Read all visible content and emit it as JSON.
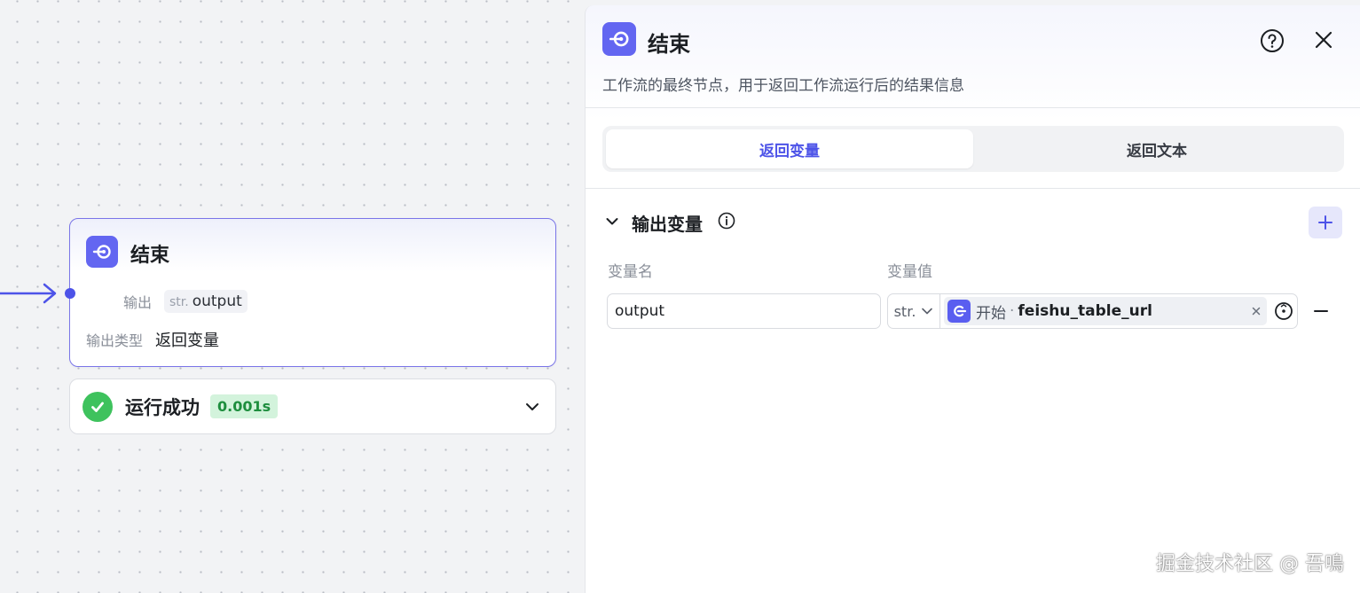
{
  "canvas": {
    "node": {
      "title": "结束",
      "output_label": "输出",
      "output_type_prefix": "str.",
      "output_name": "output",
      "output_kind_label": "输出类型",
      "output_kind_value": "返回变量",
      "icon": "end-node-icon"
    },
    "run": {
      "status": "运行成功",
      "duration": "0.001s",
      "icon": "check-circle-icon"
    }
  },
  "panel": {
    "title": "结束",
    "description": "工作流的最终节点，用于返回工作流运行后的结果信息",
    "tabs": [
      {
        "label": "返回变量",
        "active": true
      },
      {
        "label": "返回文本",
        "active": false
      }
    ],
    "section": {
      "title": "输出变量",
      "col_name": "变量名",
      "col_value": "变量值",
      "rows": [
        {
          "name": "output",
          "type": "str.",
          "ref_node": "开始",
          "ref_sep": "·",
          "ref_var": "feishu_table_url"
        }
      ]
    }
  },
  "watermark": "掘金技术社区 @ 吾鳴",
  "colors": {
    "accent": "#4d53e8",
    "node_icon": "#6366f1",
    "success": "#3ec25d",
    "success_badge_bg": "#d3f3dc"
  }
}
